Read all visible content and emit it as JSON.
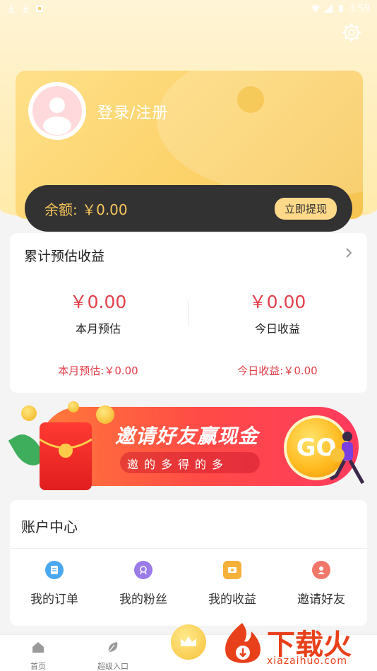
{
  "status_bar": {
    "time": "3:59"
  },
  "profile": {
    "login_label": "登录/注册"
  },
  "balance": {
    "label": "余额: ￥0.00",
    "withdraw_label": "立即提现"
  },
  "earnings": {
    "title": "累计预估收益",
    "month": {
      "amount": "￥0.00",
      "label": "本月预估",
      "sub": "本月预估:￥0.00"
    },
    "today": {
      "amount": "￥0.00",
      "label": "今日收益",
      "sub": "今日收益:￥0.00"
    }
  },
  "banner": {
    "title": "邀请好友赢现金",
    "subtitle": "邀的多得的多",
    "go_label": "GO"
  },
  "account": {
    "title": "账户中心",
    "items": [
      {
        "label": "我的订单",
        "icon": "order-icon",
        "color": "#4aa8f0"
      },
      {
        "label": "我的粉丝",
        "icon": "fans-icon",
        "color": "#9b7be8"
      },
      {
        "label": "我的收益",
        "icon": "income-icon",
        "color": "#f6b13a"
      },
      {
        "label": "邀请好友",
        "icon": "invite-icon",
        "color": "#f0786a"
      }
    ]
  },
  "bottom_nav": {
    "items": [
      {
        "label": "首页",
        "icon": "home-icon"
      },
      {
        "label": "超级入口",
        "icon": "leaf-icon"
      }
    ]
  },
  "watermark": {
    "text": "下载火",
    "domain": "xiazaihuo.com"
  },
  "colors": {
    "accent": "#f6c55a",
    "red": "#e2404a"
  }
}
